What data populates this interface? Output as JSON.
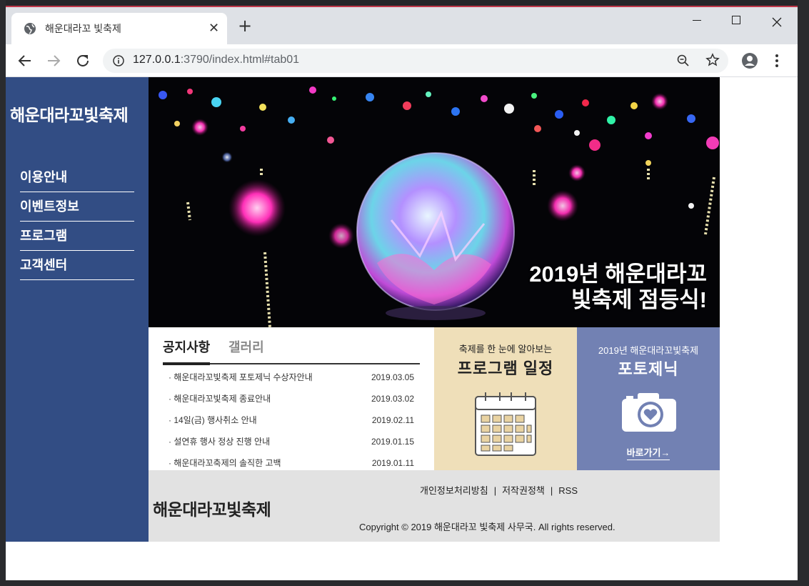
{
  "browser": {
    "tab_title": "해운대라꼬 빛축제",
    "url_host": "127.0.0.1",
    "url_rest": ":3790/index.html#tab01",
    "new_tab": "+",
    "close_tab": "✕"
  },
  "site": {
    "logo": "해운대라꼬빛축제",
    "nav": [
      "이용안내",
      "이벤트정보",
      "프로그램",
      "고객센터"
    ]
  },
  "hero": {
    "line1": "2019년 해운대라꼬",
    "line2": "빛축제 점등식!"
  },
  "notice": {
    "tabs": [
      "공지사항",
      "갤러리"
    ],
    "items": [
      {
        "title": "· 해운대라꼬빛축제 포토제닉 수상자안내",
        "date": "2019.03.05"
      },
      {
        "title": "· 해운대라꼬빛축제 종료안내",
        "date": "2019.03.02"
      },
      {
        "title": "· 14일(금) 행사취소 안내",
        "date": "2019.02.11"
      },
      {
        "title": "· 설연휴 행사 정상 진행 안내",
        "date": "2019.01.15"
      },
      {
        "title": "· 해운대라꼬축제의 솔직한 고백",
        "date": "2019.01.11"
      }
    ]
  },
  "program": {
    "subtitle": "축제를 한 눈에 알아보는",
    "title": "프로그램 일정"
  },
  "photo": {
    "subtitle": "2019년 해운대라꼬빛축제",
    "title": "포토제닉",
    "link": "바로가기→"
  },
  "footer": {
    "logo": "해운대라꼬빛축제",
    "links": [
      "개인정보처리방침",
      "저작권정책",
      "RSS"
    ],
    "separator": "|",
    "copyright": "Copyright © 2019 해운대라꼬 빛축제 사무국. All rights reserved."
  },
  "colors": {
    "sidebar": "#324d84",
    "program_bg": "#efdfb9",
    "photo_bg": "#7281b3",
    "footer_bg": "#e2e2e2"
  }
}
